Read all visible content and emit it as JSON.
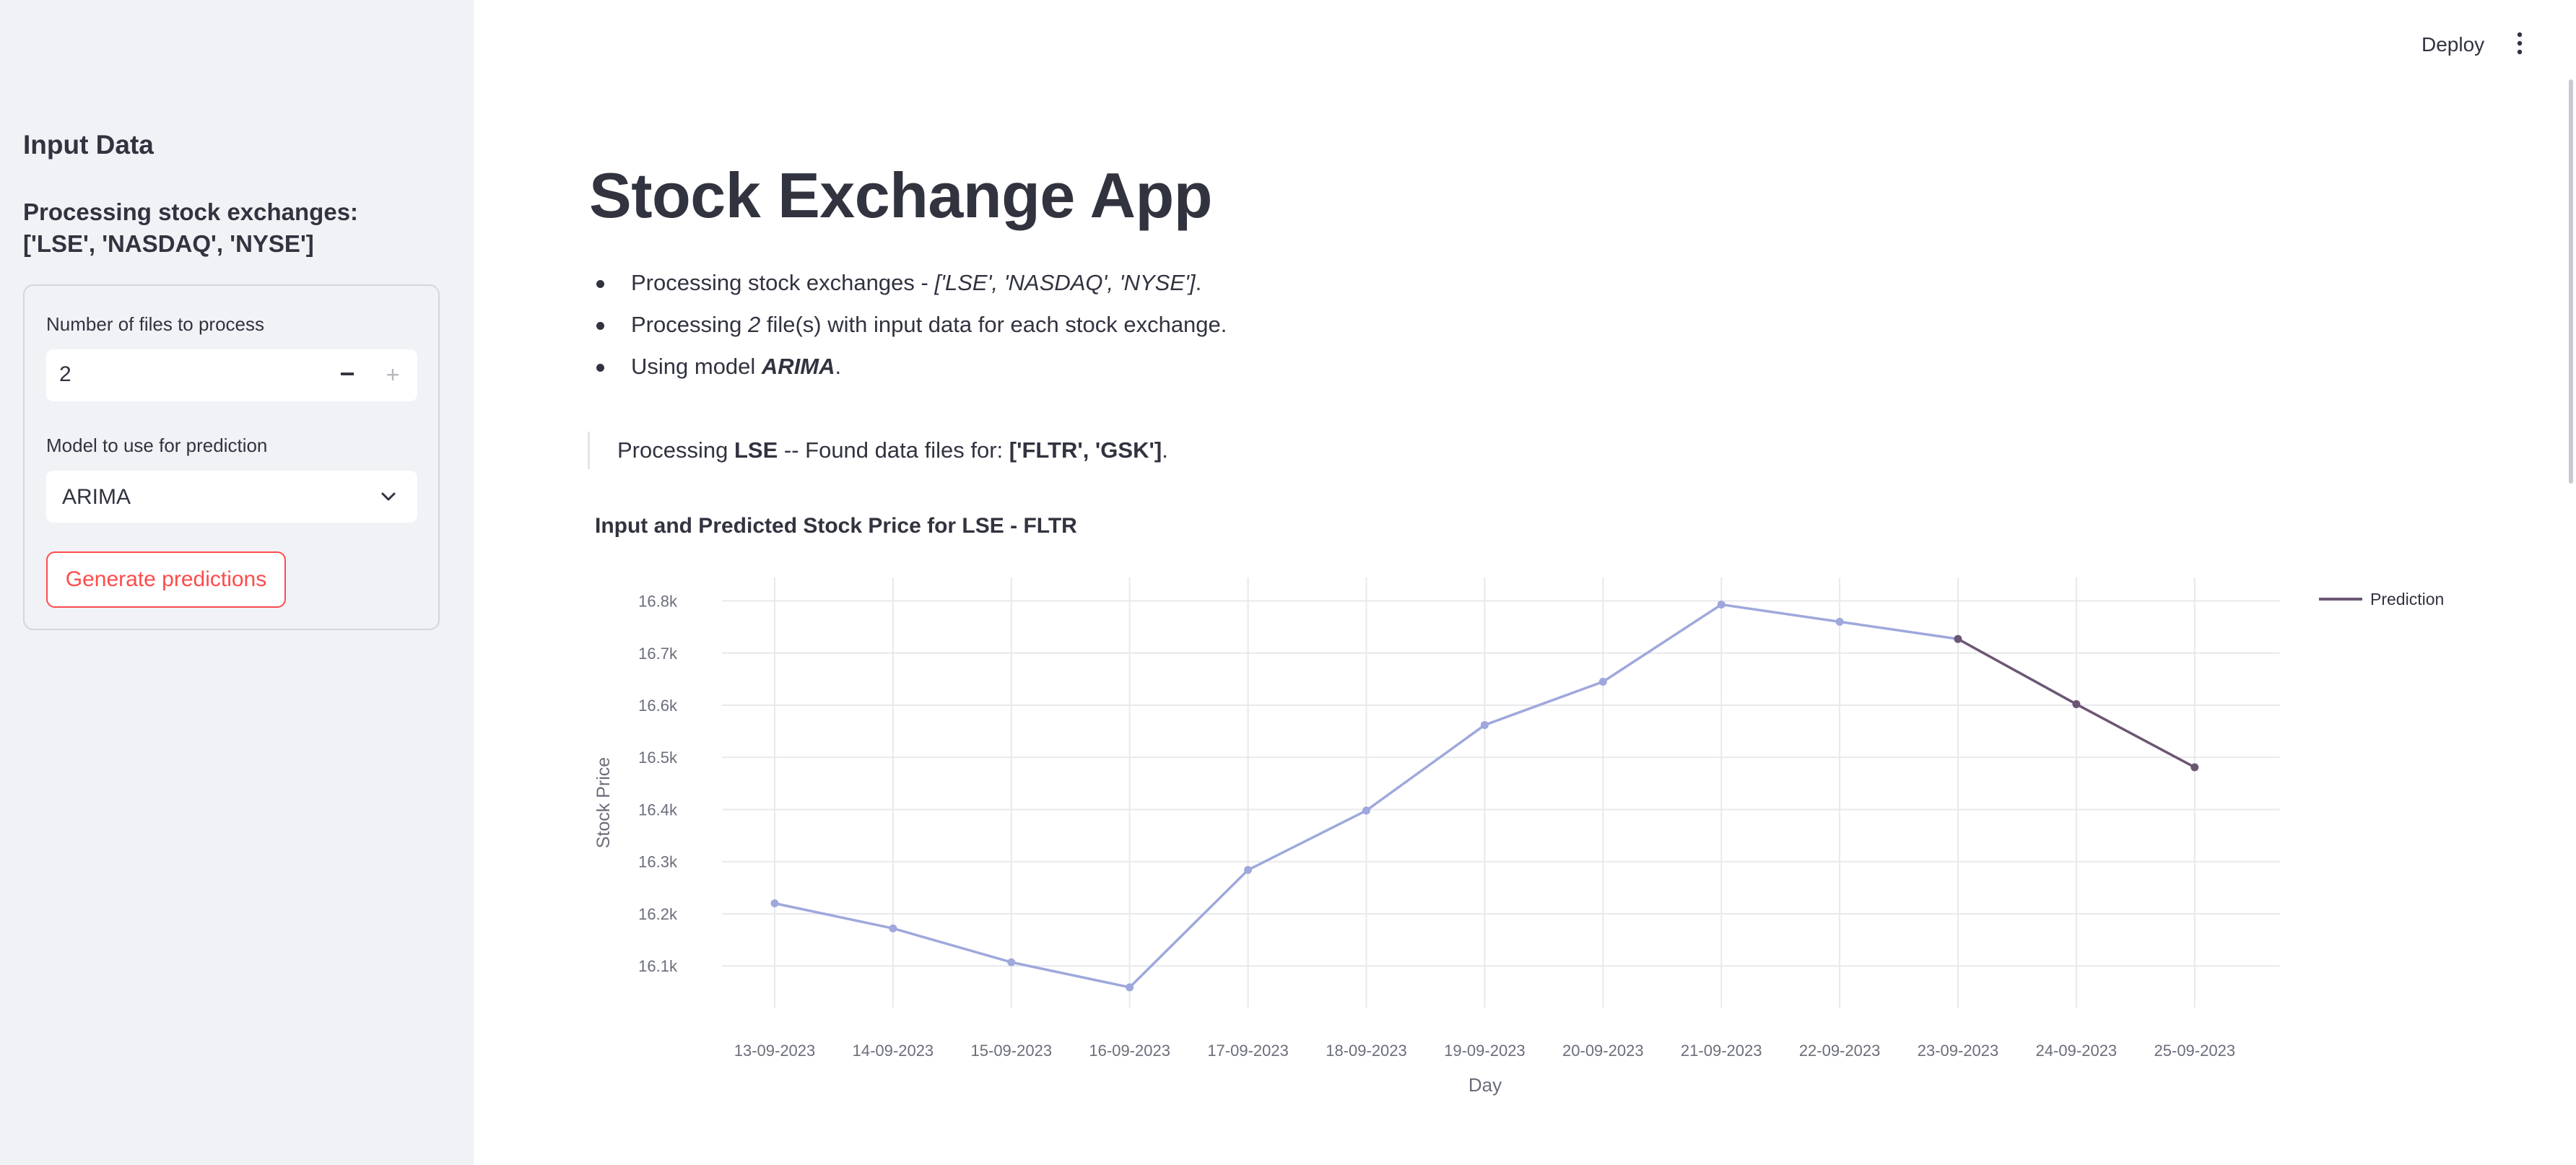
{
  "sidebar": {
    "title": "Input Data",
    "subtitle": "Processing stock exchanges: ['LSE', 'NASDAQ', 'NYSE']",
    "files_label": "Number of files to process",
    "files_value": "2",
    "minus": "−",
    "plus": "+",
    "model_label": "Model to use for prediction",
    "model_value": "ARIMA",
    "generate_label": "Generate predictions"
  },
  "header": {
    "deploy_label": "Deploy"
  },
  "main": {
    "title": "Stock Exchange App",
    "bullet1": {
      "prefix": "Processing stock exchanges - ",
      "value": "['LSE', 'NASDAQ', 'NYSE']",
      "suffix": "."
    },
    "bullet2": {
      "prefix": "Processing ",
      "value": "2",
      "suffix": " file(s) with input data for each stock exchange."
    },
    "bullet3": {
      "prefix": "Using model ",
      "value": "ARIMA",
      "suffix": "."
    },
    "note": {
      "prefix": "Processing ",
      "exchange": "LSE",
      "middle": " -- Found data files for: ",
      "files": "['FLTR', 'GSK']",
      "suffix": "."
    }
  },
  "chart_data": {
    "type": "line",
    "title": "Input and Predicted Stock Price for LSE - FLTR",
    "xlabel": "Day",
    "ylabel": "Stock Price",
    "categories": [
      "13-09-2023",
      "14-09-2023",
      "15-09-2023",
      "16-09-2023",
      "17-09-2023",
      "18-09-2023",
      "19-09-2023",
      "20-09-2023",
      "21-09-2023",
      "22-09-2023",
      "23-09-2023",
      "24-09-2023",
      "25-09-2023"
    ],
    "yticks": [
      16100,
      16200,
      16300,
      16400,
      16500,
      16600,
      16700,
      16800
    ],
    "ytick_labels": [
      "16.1k",
      "16.2k",
      "16.3k",
      "16.4k",
      "16.5k",
      "16.6k",
      "16.7k",
      "16.8k"
    ],
    "ylim": [
      16020,
      16845
    ],
    "grid": true,
    "legend_position": "top-right",
    "series": [
      {
        "name": "",
        "color": "#9fa8dc",
        "x": [
          "13-09-2023",
          "14-09-2023",
          "15-09-2023",
          "16-09-2023",
          "17-09-2023",
          "18-09-2023",
          "19-09-2023",
          "20-09-2023",
          "21-09-2023",
          "22-09-2023",
          "23-09-2023"
        ],
        "values": [
          16220,
          16172,
          16107,
          16059,
          16284,
          16398,
          16562,
          16645,
          16793,
          16760,
          16727
        ]
      },
      {
        "name": "Prediction",
        "color": "#6b5673",
        "x": [
          "23-09-2023",
          "24-09-2023",
          "25-09-2023"
        ],
        "values": [
          16727,
          16602,
          16481
        ]
      }
    ]
  }
}
